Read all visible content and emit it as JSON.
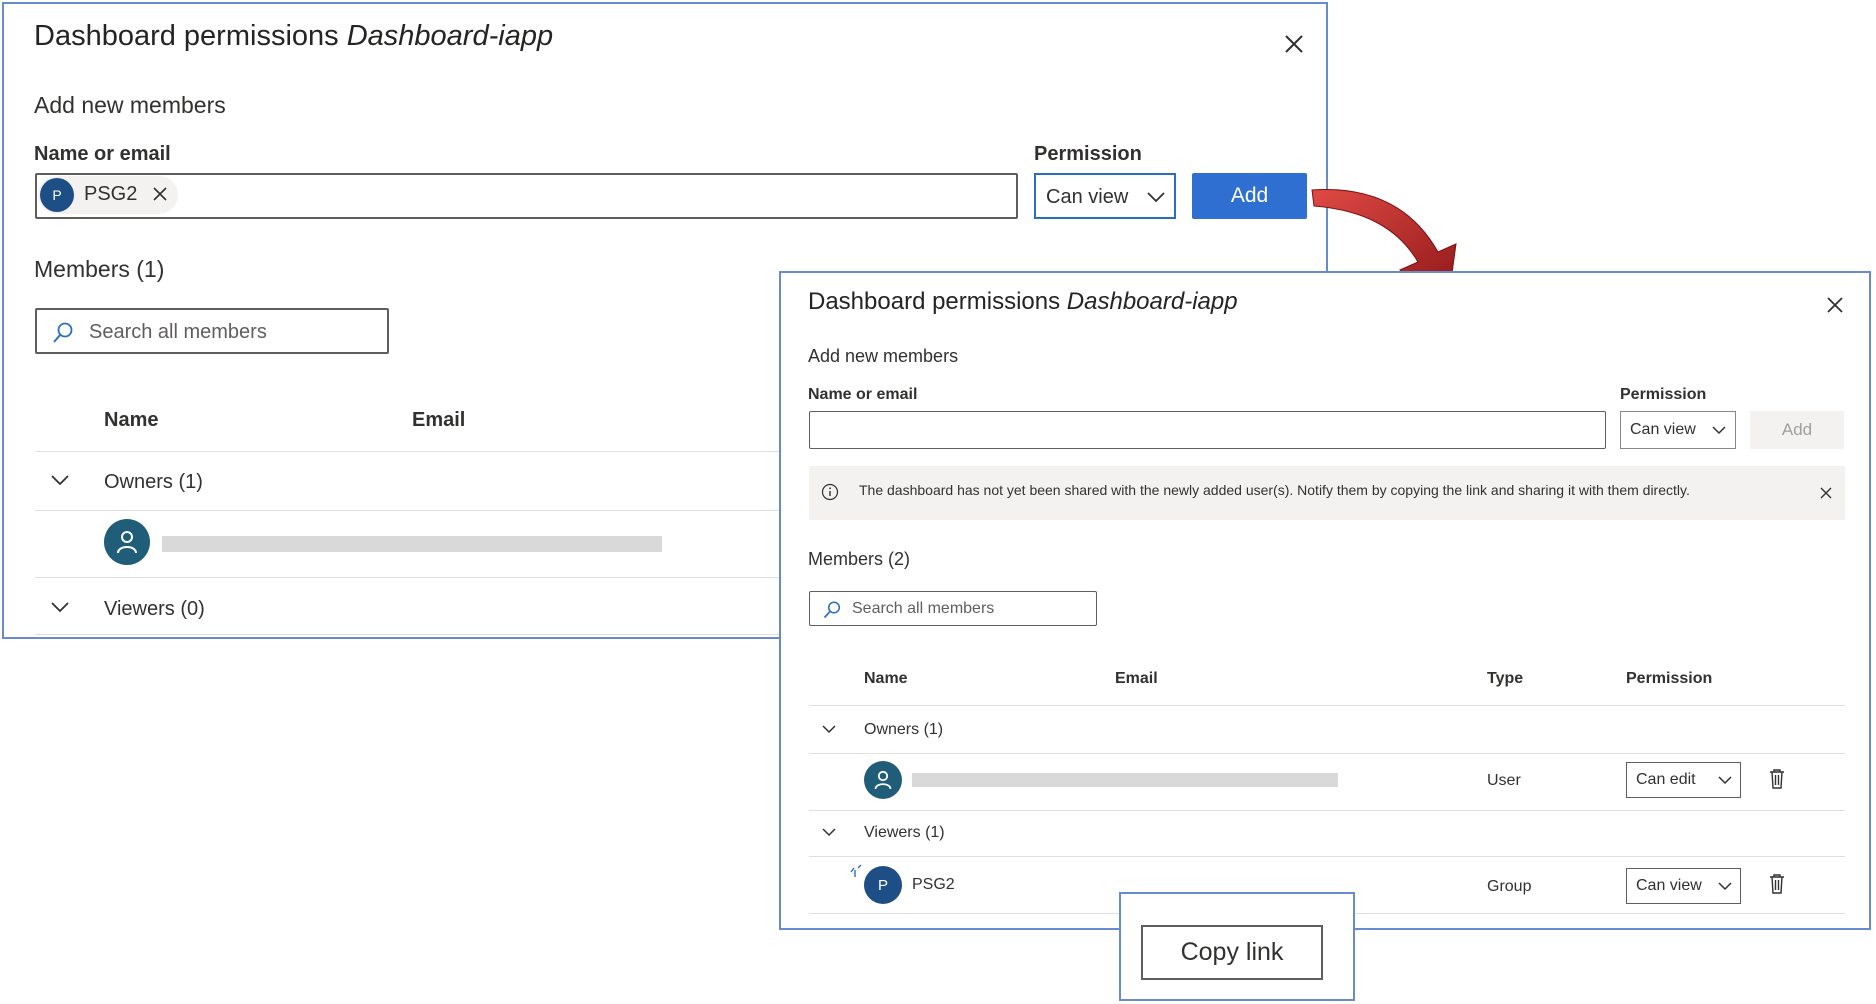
{
  "panel1": {
    "title": "Dashboard permissions",
    "title_name": "Dashboard-iapp",
    "add_section": "Add new members",
    "name_label": "Name or email",
    "permission_label": "Permission",
    "chip": {
      "initial": "P",
      "text": "PSG2"
    },
    "permission_value": "Can view",
    "add_button": "Add",
    "members_heading": "Members (1)",
    "search_placeholder": "Search all members",
    "columns": [
      "Name",
      "Email"
    ],
    "groups": [
      {
        "label": "Owners (1)"
      },
      {
        "label": "Viewers (0)"
      }
    ]
  },
  "panel2": {
    "title": "Dashboard permissions",
    "title_name": "Dashboard-iapp",
    "add_section": "Add new members",
    "name_label": "Name or email",
    "permission_label": "Permission",
    "permission_value": "Can view",
    "add_button": "Add",
    "info_message": "The dashboard has not yet been shared with the newly added user(s). Notify them by copying the link and sharing it with them directly.",
    "members_heading": "Members (2)",
    "search_placeholder": "Search all members",
    "columns": [
      "Name",
      "Email",
      "Type",
      "Permission"
    ],
    "groups": [
      {
        "label": "Owners (1)"
      },
      {
        "label": "Viewers (1)"
      }
    ],
    "rows": [
      {
        "type": "User",
        "permission": "Can edit"
      },
      {
        "initial": "P",
        "name": "PSG2",
        "type": "Group",
        "permission": "Can view"
      }
    ]
  },
  "copy_link": {
    "label": "Copy link"
  },
  "colors": {
    "accent": "#2f6fd1",
    "frame": "#6a8ad0",
    "arrow": "#c0282b",
    "avatar_group": "#1d4f86",
    "avatar_user": "#205d78"
  }
}
